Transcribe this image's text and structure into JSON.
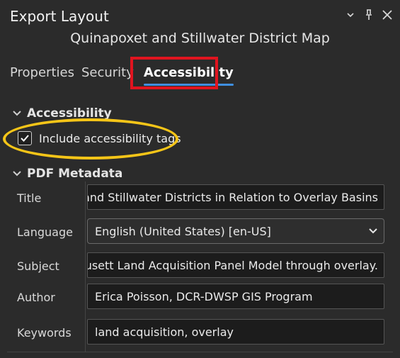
{
  "window": {
    "title": "Export Layout",
    "layout_name": "Quinapoxet and Stillwater District Map",
    "controls": {
      "menu_icon": "chevron-down-icon",
      "pin_icon": "pin-icon",
      "close_icon": "close-icon"
    }
  },
  "tabs": [
    {
      "label": "Properties"
    },
    {
      "label": "Security"
    },
    {
      "label": "Accessibility",
      "active": true
    }
  ],
  "accessibility": {
    "header": "Accessibility",
    "include_tags_label": "Include accessibility tags",
    "include_tags_checked": true
  },
  "pdf_metadata": {
    "header": "PDF Metadata",
    "fields": {
      "title": {
        "label": "Title",
        "value": "oxet and Stillwater Districts in Relation to Overlay Basins"
      },
      "language": {
        "label": "Language",
        "value": "English (United States) [en-US]"
      },
      "subject": {
        "label": "Subject",
        "value": "achusett Land Acquisition Panel Model through overlay."
      },
      "author": {
        "label": "Author",
        "value": "Erica Poisson, DCR-DWSP GIS Program"
      },
      "keywords": {
        "label": "Keywords",
        "value": "land acquisition, overlay"
      }
    }
  },
  "annotations": {
    "highlight_box_color": "#e0141f",
    "highlight_ellipse_color": "#f5c518",
    "active_tab_underline_color": "#3f8fe0"
  }
}
